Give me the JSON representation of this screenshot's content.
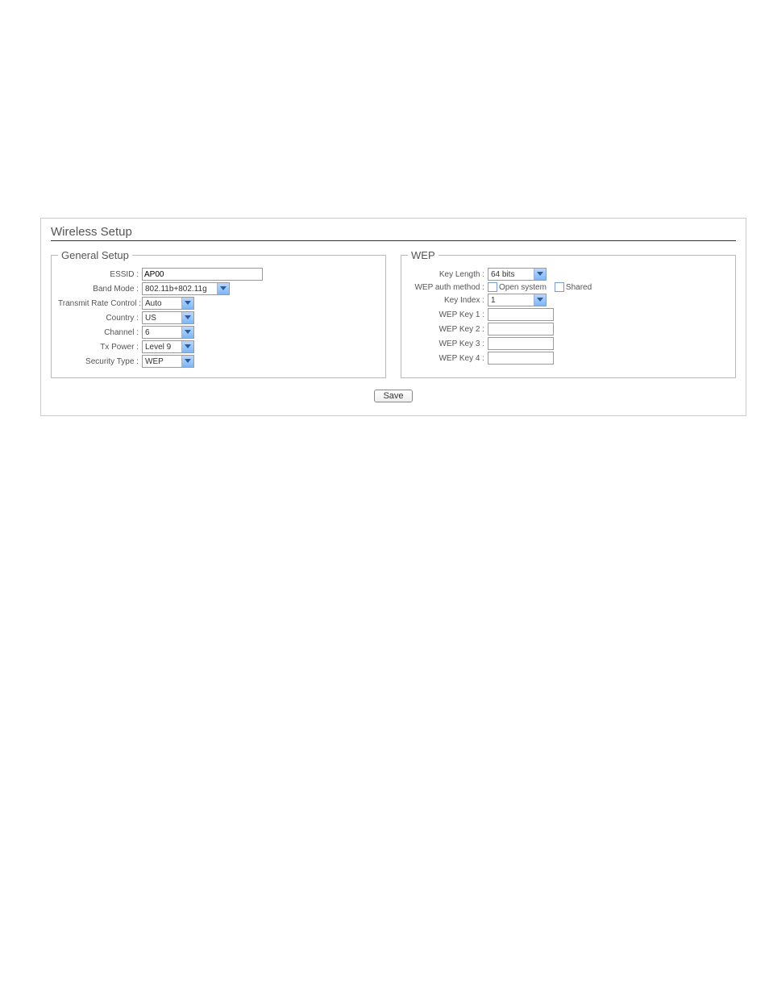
{
  "page_title": "Wireless Setup",
  "general": {
    "legend": "General Setup",
    "essid_label": "ESSID :",
    "essid_value": "AP00",
    "band_mode_label": "Band Mode :",
    "band_mode_value": "802.11b+802.11g",
    "txrate_label": "Transmit Rate Control :",
    "txrate_value": "Auto",
    "country_label": "Country :",
    "country_value": "US",
    "channel_label": "Channel :",
    "channel_value": "6",
    "txpower_label": "Tx Power :",
    "txpower_value": "Level 9",
    "security_label": "Security Type :",
    "security_value": "WEP"
  },
  "wep": {
    "legend": "WEP",
    "key_length_label": "Key Length :",
    "key_length_value": "64 bits",
    "auth_method_label": "WEP auth method :",
    "auth_open_label": "Open system",
    "auth_shared_label": "Shared",
    "key_index_label": "Key Index :",
    "key_index_value": "1",
    "key1_label": "WEP Key 1 :",
    "key1_value": "",
    "key2_label": "WEP Key 2 :",
    "key2_value": "",
    "key3_label": "WEP Key 3 :",
    "key3_value": "",
    "key4_label": "WEP Key 4 :",
    "key4_value": ""
  },
  "save_label": "Save"
}
